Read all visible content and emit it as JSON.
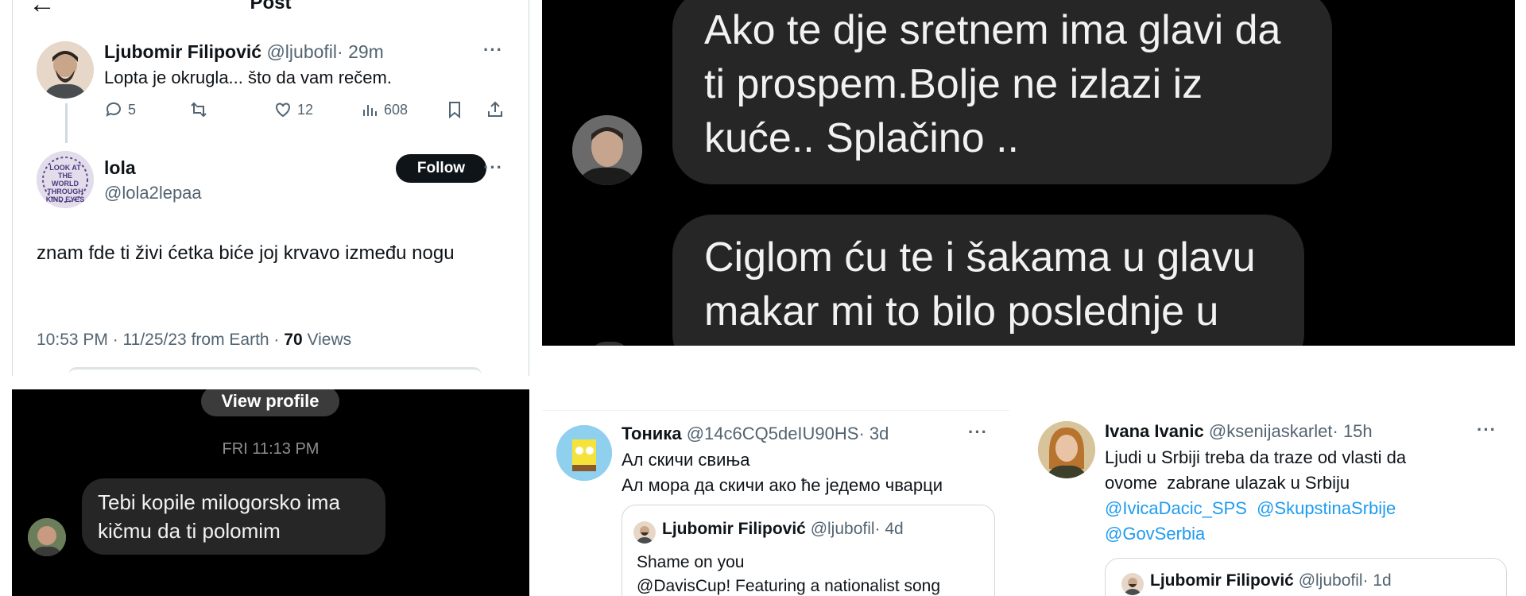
{
  "post_panel": {
    "header_title": "Post",
    "original": {
      "name": "Ljubomir Filipović",
      "handle": "@ljubofil",
      "time": "· 29m",
      "text": "Lopta je okrugla... što da vam rečem.",
      "replies": "5",
      "likes": "12",
      "views": "608"
    },
    "reply": {
      "name": "lola",
      "handle": "@lola2lepaa",
      "follow_label": "Follow",
      "avatar_text": "LOOK AT THE WORLD THROUGH KIND EYES",
      "text": "znam fde ti živi ćetka biće joj krvavo između nogu",
      "meta_time": "10:53 PM · 11/25/23 from Earth ·",
      "meta_views_count": "70",
      "meta_views_label": "Views"
    }
  },
  "dark_chat_large": {
    "message1": "Ako te dje sretnem ima glavi da ti prospem.Bolje ne izlazi iz kuće.. Splačino ..",
    "message2": "Ciglom ću te i šakama u glavu makar mi to bilo poslednje u"
  },
  "dark_chat_small": {
    "view_profile": "View profile",
    "timestamp": "FRI 11:13 PM",
    "message": "Tebi kopile milogorsko ima kičmu da ti polomim"
  },
  "tweet_tonika": {
    "name": "Тоника",
    "handle": "@14c6CQ5deIU90HS",
    "time": "· 3d",
    "line1": "Ал скичи свиња",
    "line2": "Ал мора да скичи ако ће једемо чварци",
    "quote_name": "Ljubomir Filipović",
    "quote_handle": "@ljubofil",
    "quote_time": "· 4d",
    "quote_line1": "Shame on you",
    "quote_line2": "@DavisCup! Featuring a nationalist song"
  },
  "tweet_ivana": {
    "name": "Ivana Ivanic",
    "handle": "@ksenijaskarlet",
    "time": "· 15h",
    "line1": "Ljudi u Srbiji treba da traze od vlasti da",
    "line2": "ovome  zabrane ulazak u Srbiju",
    "mention1": "@IvicaDacic_SPS",
    "mention2": "@SkupstinaSrbije",
    "mention3": "@GovSerbia",
    "quote_name": "Ljubomir Filipović",
    "quote_handle": "@ljubofil",
    "quote_time": "· 1d"
  },
  "colors": {
    "link": "#1d9bf0",
    "bubble": "#262626",
    "text_gray": "#536471"
  }
}
